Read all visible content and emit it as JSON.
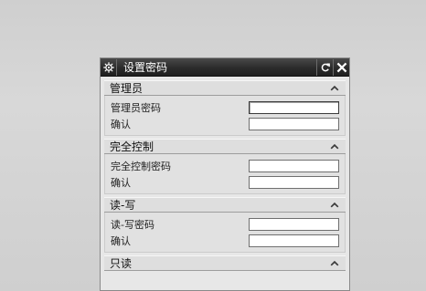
{
  "dialog": {
    "title": "设置密码",
    "buttons": {
      "settings_icon": "gear-icon",
      "reset_icon": "reset-icon",
      "close_icon": "close-icon"
    },
    "sections": [
      {
        "title": "管理员",
        "fields": [
          {
            "label": "管理员密码",
            "value": "",
            "placeholder": ""
          },
          {
            "label": "确认",
            "value": "",
            "placeholder": ""
          }
        ]
      },
      {
        "title": "完全控制",
        "fields": [
          {
            "label": "完全控制密码",
            "value": "",
            "placeholder": ""
          },
          {
            "label": "确认",
            "value": "",
            "placeholder": ""
          }
        ]
      },
      {
        "title": "读-写",
        "fields": [
          {
            "label": "读-写密码",
            "value": "",
            "placeholder": ""
          },
          {
            "label": "确认",
            "value": "",
            "placeholder": ""
          }
        ]
      },
      {
        "title": "只读",
        "fields": []
      }
    ]
  }
}
